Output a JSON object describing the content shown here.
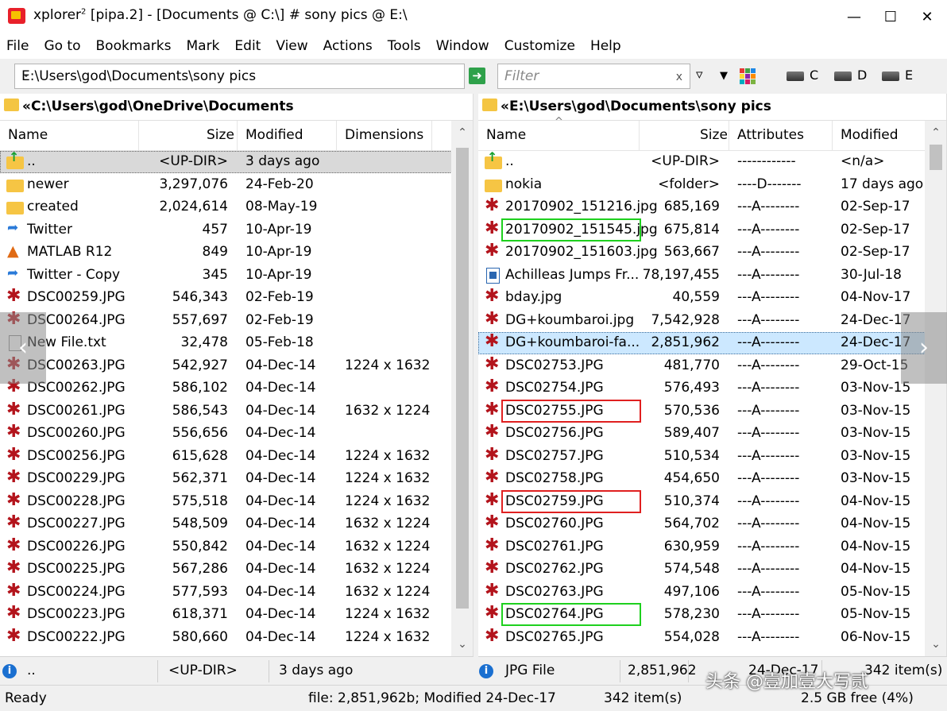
{
  "window": {
    "title_app": "xplorer",
    "title_sup": "2",
    "title_rest": " [pipa.2] - [Documents @ C:\\] # sony pics @ E:\\",
    "minimize": "—",
    "maximize": "☐",
    "close": "✕"
  },
  "menu": [
    "File",
    "Go to",
    "Bookmarks",
    "Mark",
    "Edit",
    "View",
    "Actions",
    "Tools",
    "Window",
    "Customize",
    "Help"
  ],
  "toolbar": {
    "address": "E:\\Users\\god\\Documents\\sony pics",
    "filter_placeholder": "Filter",
    "filter_clear": "x",
    "drives": [
      "C",
      "D",
      "E"
    ]
  },
  "left_pane": {
    "path": "«C:\\Users\\god\\OneDrive\\Documents",
    "columns": [
      "Name",
      "Size",
      "Modified",
      "Dimensions"
    ],
    "rows": [
      {
        "icon": "updir",
        "name": "..",
        "size": "<UP-DIR>",
        "modified": "3 days ago",
        "dim": ""
      },
      {
        "icon": "folder",
        "name": "newer",
        "size": "3,297,076",
        "modified": "24-Feb-20",
        "dim": ""
      },
      {
        "icon": "folder",
        "name": "created",
        "size": "2,024,614",
        "modified": "08-May-19",
        "dim": ""
      },
      {
        "icon": "app",
        "name": "Twitter",
        "size": "457",
        "modified": "10-Apr-19",
        "dim": ""
      },
      {
        "icon": "matlab",
        "name": "MATLAB R12",
        "size": "849",
        "modified": "10-Apr-19",
        "dim": ""
      },
      {
        "icon": "app",
        "name": "Twitter - Copy",
        "size": "345",
        "modified": "10-Apr-19",
        "dim": ""
      },
      {
        "icon": "jpg",
        "name": "DSC00259.JPG",
        "size": "546,343",
        "modified": "02-Feb-19",
        "dim": ""
      },
      {
        "icon": "jpg",
        "name": "DSC00264.JPG",
        "size": "557,697",
        "modified": "02-Feb-19",
        "dim": ""
      },
      {
        "icon": "txt",
        "name": "New File.txt",
        "size": "32,478",
        "modified": "05-Feb-18",
        "dim": ""
      },
      {
        "icon": "jpg",
        "name": "DSC00263.JPG",
        "size": "542,927",
        "modified": "04-Dec-14",
        "dim": "1224 x 1632"
      },
      {
        "icon": "jpg",
        "name": "DSC00262.JPG",
        "size": "586,102",
        "modified": "04-Dec-14",
        "dim": ""
      },
      {
        "icon": "jpg",
        "name": "DSC00261.JPG",
        "size": "586,543",
        "modified": "04-Dec-14",
        "dim": "1632 x 1224"
      },
      {
        "icon": "jpg",
        "name": "DSC00260.JPG",
        "size": "556,656",
        "modified": "04-Dec-14",
        "dim": ""
      },
      {
        "icon": "jpg",
        "name": "DSC00256.JPG",
        "size": "615,628",
        "modified": "04-Dec-14",
        "dim": "1224 x 1632"
      },
      {
        "icon": "jpg",
        "name": "DSC00229.JPG",
        "size": "562,371",
        "modified": "04-Dec-14",
        "dim": "1224 x 1632"
      },
      {
        "icon": "jpg",
        "name": "DSC00228.JPG",
        "size": "575,518",
        "modified": "04-Dec-14",
        "dim": "1224 x 1632"
      },
      {
        "icon": "jpg",
        "name": "DSC00227.JPG",
        "size": "548,509",
        "modified": "04-Dec-14",
        "dim": "1632 x 1224"
      },
      {
        "icon": "jpg",
        "name": "DSC00226.JPG",
        "size": "550,842",
        "modified": "04-Dec-14",
        "dim": "1632 x 1224"
      },
      {
        "icon": "jpg",
        "name": "DSC00225.JPG",
        "size": "567,286",
        "modified": "04-Dec-14",
        "dim": "1632 x 1224"
      },
      {
        "icon": "jpg",
        "name": "DSC00224.JPG",
        "size": "577,593",
        "modified": "04-Dec-14",
        "dim": "1632 x 1224"
      },
      {
        "icon": "jpg",
        "name": "DSC00223.JPG",
        "size": "618,371",
        "modified": "04-Dec-14",
        "dim": "1224 x 1632"
      },
      {
        "icon": "jpg",
        "name": "DSC00222.JPG",
        "size": "580,660",
        "modified": "04-Dec-14",
        "dim": "1224 x 1632"
      }
    ],
    "status": {
      "name": "..",
      "size": "<UP-DIR>",
      "modified": "3 days ago"
    }
  },
  "right_pane": {
    "path": "«E:\\Users\\god\\Documents\\sony pics",
    "sort_indicator": "^",
    "columns": [
      "Name",
      "Size",
      "Attributes",
      "Modified"
    ],
    "rows": [
      {
        "icon": "updir",
        "name": "..",
        "size": "<UP-DIR>",
        "attr": "------------",
        "modified": "<n/a>"
      },
      {
        "icon": "folder",
        "name": "nokia",
        "size": "<folder>",
        "attr": "----D-------",
        "modified": "17 days ago"
      },
      {
        "icon": "jpg",
        "name": "20170902_151216.jpg",
        "size": "685,169",
        "attr": "---A--------",
        "modified": "02-Sep-17"
      },
      {
        "icon": "jpg",
        "name": "20170902_151545.jpg",
        "size": "675,814",
        "attr": "---A--------",
        "modified": "02-Sep-17",
        "mark": "green"
      },
      {
        "icon": "jpg",
        "name": "20170902_151603.jpg",
        "size": "563,667",
        "attr": "---A--------",
        "modified": "02-Sep-17"
      },
      {
        "icon": "vid",
        "name": "Achilleas Jumps Fr...",
        "size": "78,197,455",
        "attr": "---A--------",
        "modified": "30-Jul-18"
      },
      {
        "icon": "jpg",
        "name": "bday.jpg",
        "size": "40,559",
        "attr": "---A--------",
        "modified": "04-Nov-17"
      },
      {
        "icon": "jpg",
        "name": "DG+koumbaroi.jpg",
        "size": "7,542,928",
        "attr": "---A--------",
        "modified": "24-Dec-17"
      },
      {
        "icon": "jpg",
        "name": "DG+koumbaroi-fa...",
        "size": "2,851,962",
        "attr": "---A--------",
        "modified": "24-Dec-17",
        "selected": true
      },
      {
        "icon": "jpg",
        "name": "DSC02753.JPG",
        "size": "481,770",
        "attr": "---A--------",
        "modified": "29-Oct-15"
      },
      {
        "icon": "jpg",
        "name": "DSC02754.JPG",
        "size": "576,493",
        "attr": "---A--------",
        "modified": "03-Nov-15"
      },
      {
        "icon": "jpg",
        "name": "DSC02755.JPG",
        "size": "570,536",
        "attr": "---A--------",
        "modified": "03-Nov-15",
        "mark": "red"
      },
      {
        "icon": "jpg",
        "name": "DSC02756.JPG",
        "size": "589,407",
        "attr": "---A--------",
        "modified": "03-Nov-15"
      },
      {
        "icon": "jpg",
        "name": "DSC02757.JPG",
        "size": "510,534",
        "attr": "---A--------",
        "modified": "03-Nov-15"
      },
      {
        "icon": "jpg",
        "name": "DSC02758.JPG",
        "size": "454,650",
        "attr": "---A--------",
        "modified": "03-Nov-15"
      },
      {
        "icon": "jpg",
        "name": "DSC02759.JPG",
        "size": "510,374",
        "attr": "---A--------",
        "modified": "04-Nov-15",
        "mark": "red"
      },
      {
        "icon": "jpg",
        "name": "DSC02760.JPG",
        "size": "564,702",
        "attr": "---A--------",
        "modified": "04-Nov-15"
      },
      {
        "icon": "jpg",
        "name": "DSC02761.JPG",
        "size": "630,959",
        "attr": "---A--------",
        "modified": "04-Nov-15"
      },
      {
        "icon": "jpg",
        "name": "DSC02762.JPG",
        "size": "574,548",
        "attr": "---A--------",
        "modified": "04-Nov-15"
      },
      {
        "icon": "jpg",
        "name": "DSC02763.JPG",
        "size": "497,106",
        "attr": "---A--------",
        "modified": "05-Nov-15"
      },
      {
        "icon": "jpg",
        "name": "DSC02764.JPG",
        "size": "578,230",
        "attr": "---A--------",
        "modified": "05-Nov-15",
        "mark": "green"
      },
      {
        "icon": "jpg",
        "name": "DSC02765.JPG",
        "size": "554,028",
        "attr": "---A--------",
        "modified": "06-Nov-15"
      }
    ],
    "status": {
      "type": "JPG File",
      "size": "2,851,962",
      "modified": "24-Dec-17",
      "count": "342 item(s)"
    }
  },
  "statusbar": {
    "ready": "Ready",
    "fileinfo": "file: 2,851,962b; Modified 24-Dec-17",
    "items": "342 item(s)",
    "free": "2.5 GB free (4%)"
  },
  "overlay": {
    "prev": "‹",
    "next": "›",
    "watermark": "头条 @壹加壹大写贰"
  },
  "colors": {
    "mark_green": "#1ed01e",
    "mark_red": "#e02020",
    "selected_row": "#cce8ff",
    "jpg_icon": "#b3141c"
  }
}
